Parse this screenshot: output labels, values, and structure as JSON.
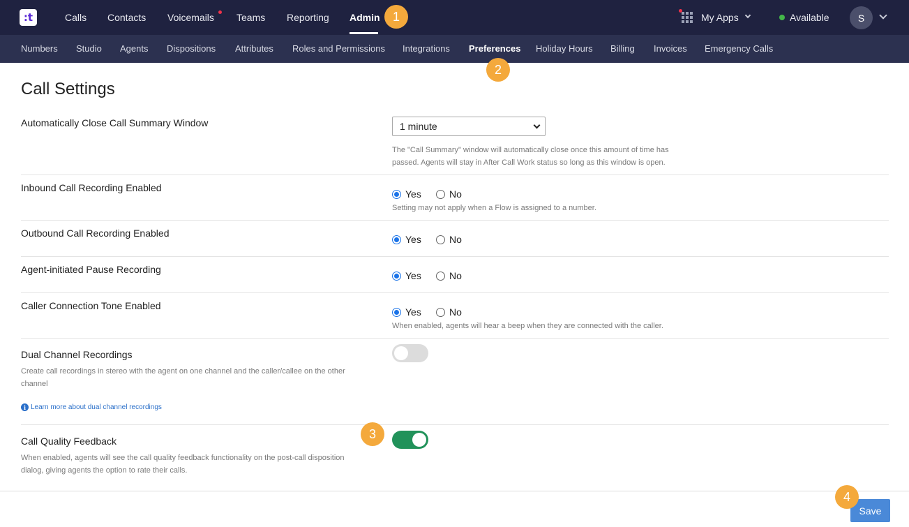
{
  "app": {
    "logo_text": ":t"
  },
  "topnav": {
    "items": [
      {
        "label": "Calls"
      },
      {
        "label": "Contacts"
      },
      {
        "label": "Voicemails"
      },
      {
        "label": "Teams"
      },
      {
        "label": "Reporting"
      },
      {
        "label": "Admin"
      }
    ],
    "active": "Admin",
    "my_apps": "My Apps",
    "status": "Available",
    "avatar_initial": "S"
  },
  "subnav": {
    "items": [
      {
        "label": "Numbers"
      },
      {
        "label": "Studio"
      },
      {
        "label": "Agents"
      },
      {
        "label": "Dispositions"
      },
      {
        "label": "Attributes"
      },
      {
        "label": "Roles and Permissions"
      },
      {
        "label": "Integrations"
      },
      {
        "label": "Preferences"
      },
      {
        "label": "Holiday Hours"
      },
      {
        "label": "Billing"
      },
      {
        "label": "Invoices"
      },
      {
        "label": "Emergency Calls"
      }
    ],
    "active": "Preferences"
  },
  "badges": [
    "1",
    "2",
    "3",
    "4"
  ],
  "page": {
    "title": "Call Settings"
  },
  "settings": {
    "auto_close": {
      "label": "Automatically Close Call Summary Window",
      "value": "1 minute",
      "help_1": "The \"Call Summary\" window will automatically close once this amount of time has",
      "help_2": "passed. Agents will stay in After Call Work status so long as this window is open."
    },
    "inbound": {
      "label": "Inbound Call Recording Enabled",
      "selected": "Yes",
      "help": "Setting may not apply when a Flow is assigned to a number."
    },
    "outbound": {
      "label": "Outbound Call Recording Enabled",
      "selected": "Yes"
    },
    "pause": {
      "label": "Agent-initiated Pause Recording",
      "selected": "Yes"
    },
    "tone": {
      "label": "Caller Connection Tone Enabled",
      "selected": "Yes",
      "help": "When enabled, agents will hear a beep when they are connected with the caller."
    },
    "dual": {
      "label": "Dual Channel Recordings",
      "enabled": false,
      "help_1": "Create call recordings in stereo with the agent on one channel and the caller/callee on the other",
      "help_2": "channel",
      "link": "Learn more about dual channel recordings"
    },
    "quality": {
      "label": "Call Quality Feedback",
      "enabled": true,
      "help_1": "When enabled, agents will see the call quality feedback functionality on the post-call disposition",
      "help_2": "dialog, giving agents the option to rate their calls."
    },
    "yes_label": "Yes",
    "no_label": "No"
  },
  "footer": {
    "save_label": "Save"
  },
  "colors": {
    "topbar": "#1f2240",
    "subbar": "#2c3150",
    "badge": "#f4a93c",
    "toggle_on": "#21925a",
    "save": "#4a89d8",
    "radio": "#1a73e8"
  }
}
